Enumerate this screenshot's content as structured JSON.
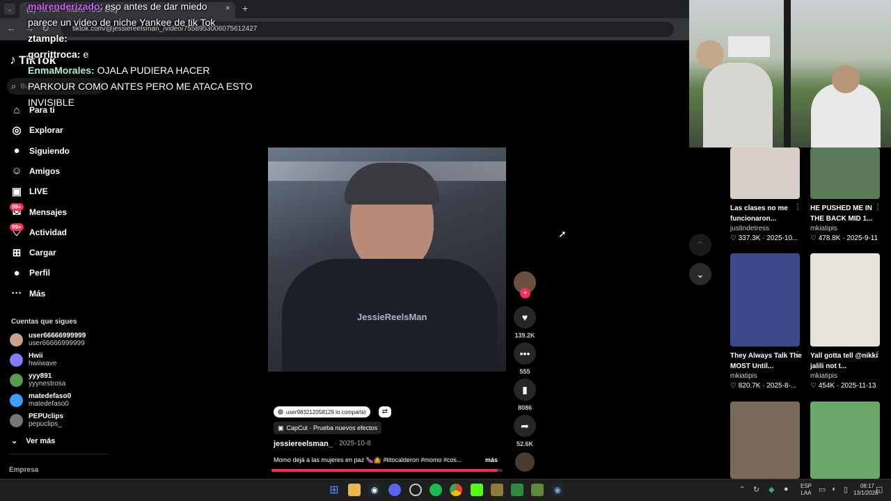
{
  "browser": {
    "tab_title": "(2) TikTok - Make Your Day",
    "new_tab": "+",
    "close_tab": "×",
    "url": "tiktok.com/@jessiereelsman_/video/7558953006075612427"
  },
  "chat": [
    {
      "user": "malrenderizado",
      "color": "#d45cff",
      "text": ": eso antes de dar miedo"
    },
    {
      "user": "",
      "color": "#fff",
      "text": "parece un video de niche Yankee de tik Tok"
    },
    {
      "user": "ztample:",
      "color": "#ffffff",
      "text": ""
    },
    {
      "user": "gorrittroca:",
      "color": "#ffffff",
      "text": " e"
    },
    {
      "user": "EnmaMorales:",
      "color": "#a8f2d9",
      "text": " OJALA PUDIERA HACER"
    },
    {
      "user": "",
      "color": "#fff",
      "text": "PARKOUR COMO ANTES PERO ME ATACA ESTO"
    },
    {
      "user": "",
      "color": "#fff",
      "text": "INVISIBLE"
    }
  ],
  "tiktok": {
    "logo": "TikTok",
    "search_placeholder": "Buscar",
    "nav": [
      {
        "label": "Para ti",
        "icon": "home-icon",
        "glyph": "⌂"
      },
      {
        "label": "Explorar",
        "icon": "compass-icon",
        "glyph": "◎"
      },
      {
        "label": "Siguiendo",
        "icon": "following-icon",
        "glyph": "●"
      },
      {
        "label": "Amigos",
        "icon": "friends-icon",
        "glyph": "☺"
      },
      {
        "label": "LIVE",
        "icon": "live-icon",
        "glyph": "▣"
      },
      {
        "label": "Mensajes",
        "icon": "messages-icon",
        "glyph": "✉",
        "badge": "99+"
      },
      {
        "label": "Actividad",
        "icon": "activity-icon",
        "glyph": "♡",
        "badge": "99+"
      },
      {
        "label": "Cargar",
        "icon": "upload-icon",
        "glyph": "⊞"
      },
      {
        "label": "Perfil",
        "icon": "profile-icon",
        "glyph": "●"
      },
      {
        "label": "Más",
        "icon": "more-icon",
        "glyph": "···"
      }
    ],
    "following_title": "Cuentas que sigues",
    "following": [
      {
        "name": "user66666999999",
        "handle": "user66666999999",
        "color": "#c9a18c"
      },
      {
        "name": "Hwii",
        "handle": "hwiiwave",
        "color": "#7f7fff"
      },
      {
        "name": "yyy891",
        "handle": "yyynestrosa",
        "color": "#5a9a4a"
      },
      {
        "name": "matedefaso0",
        "handle": "matedefaso0",
        "color": "#3aa0ff"
      },
      {
        "name": "PEPUclips",
        "handle": "pepuclips_",
        "color": "#777"
      }
    ],
    "see_more": "Ver más",
    "company": "Empresa"
  },
  "video": {
    "watermark": "JessieReelsMan",
    "shared_by": "user983212058129 lo compartió",
    "effect": "CapCut · Prueba nuevos efectos",
    "author": "jessiereelsman_",
    "date": "· 2025-10-8",
    "caption": "Momo dejá a las mujeres en paz 🍆🤷 #titocalderon #momo #cos...",
    "more": "más",
    "progress": 0.98,
    "likes": "139.2K",
    "comments": "555",
    "saves": "8086",
    "shares": "52.6K"
  },
  "suggested": [
    {
      "caption": "Las clases no me funcionaron...",
      "author": "justindetress",
      "likes": "337.3K",
      "date": "2025-10...",
      "color": "#d8d0c8"
    },
    {
      "caption": "HE PUSHED ME IN THE BACK MID 1...",
      "author": "mkiatipis",
      "likes": "478.8K",
      "date": "2025-9-11",
      "color": "#5a7a5a"
    },
    {
      "caption": "They Always Talk The MOST Until...",
      "author": "mkiatipis",
      "likes": "820.7K",
      "date": "2025-8-...",
      "color": "#3a4a8a"
    },
    {
      "caption": "Yall gotta tell @nikki jalili not t...",
      "author": "mkiatipis",
      "likes": "454K",
      "date": "2025-11-13",
      "color": "#e8e2dc"
    },
    {
      "caption": "",
      "author": "",
      "likes": "",
      "date": "",
      "color": "#7a6a5a"
    },
    {
      "caption": "",
      "author": "",
      "likes": "",
      "date": "",
      "color": "#6aa86a"
    }
  ],
  "taskbar": {
    "lang1": "ESP",
    "lang2": "LAA",
    "time": "08:17",
    "date": "13/1/2026"
  }
}
